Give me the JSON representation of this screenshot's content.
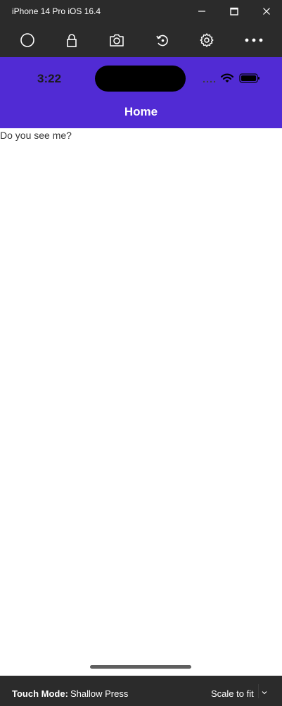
{
  "window": {
    "title": "iPhone 14 Pro iOS 16.4",
    "controls": [
      "minimize-icon",
      "maximize-icon",
      "close-icon"
    ]
  },
  "toolbar": {
    "icons": [
      "home-circle-icon",
      "lock-icon",
      "screenshot-camera-icon",
      "rotate-icon",
      "settings-gear-icon",
      "more-ellipsis-icon"
    ]
  },
  "device": {
    "status_bar": {
      "time": "3:22",
      "icons": [
        "signal-dots-icon",
        "wifi-icon",
        "battery-icon"
      ]
    },
    "nav": {
      "title": "Home",
      "background": "#512bd4"
    },
    "content": {
      "label": "Do you see me?"
    }
  },
  "bottom_bar": {
    "touch_mode_label": "Touch Mode:",
    "touch_mode_value": "Shallow Press",
    "scale_label": "Scale to fit"
  }
}
